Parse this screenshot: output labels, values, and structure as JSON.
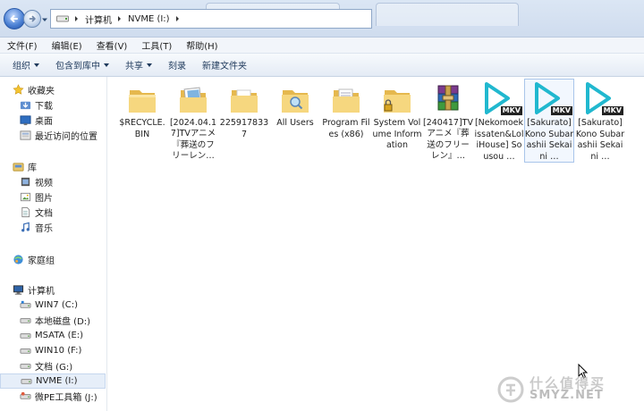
{
  "address": {
    "crumbs": [
      "计算机",
      "NVME (I:)"
    ]
  },
  "menu": [
    "文件(F)",
    "编辑(E)",
    "查看(V)",
    "工具(T)",
    "帮助(H)"
  ],
  "toolbar": {
    "organize": "组织",
    "include_in_library": "包含到库中",
    "share": "共享",
    "burn": "刻录",
    "new_folder": "新建文件夹"
  },
  "nav": {
    "favorites": "收藏夹",
    "downloads": "下载",
    "desktop": "桌面",
    "recent": "最近访问的位置",
    "libraries": "库",
    "videos": "视频",
    "pictures": "图片",
    "documents": "文档",
    "music": "音乐",
    "homegroup": "家庭组",
    "computer": "计算机",
    "drives": [
      {
        "label": "WIN7 (C:)"
      },
      {
        "label": "本地磁盘 (D:)"
      },
      {
        "label": "MSATA (E:)"
      },
      {
        "label": "WIN10 (F:)"
      },
      {
        "label": "文档 (G:)"
      },
      {
        "label": "NVME (I:)"
      },
      {
        "label": "微PE工具箱 (J:)"
      }
    ]
  },
  "files": [
    {
      "label": "$RECYCLE.BIN",
      "icon": "folder-icon"
    },
    {
      "label": "[2024.04.17]TVアニメ『葬送のフリーレン…",
      "icon": "folder-images-icon"
    },
    {
      "label": "2259178337",
      "icon": "folder-icon"
    },
    {
      "label": "All Users",
      "icon": "folder-search-icon"
    },
    {
      "label": "Program Files (x86)",
      "icon": "folder-docs-icon"
    },
    {
      "label": "System Volume Information",
      "icon": "locked-folder-icon"
    },
    {
      "label": "[240417]TVアニメ『葬送のフリーレン』…",
      "icon": "winrar-archive-icon"
    },
    {
      "label": "[Nekomoekissaten&LoliHouse] Sousou …",
      "icon": "mkv-file-icon"
    },
    {
      "label": "[Sakurato] Kono Subarashii Sekai ni …",
      "icon": "mkv-file-icon"
    },
    {
      "label": "[Sakurato] Kono Subarashii Sekai ni …",
      "icon": "mkv-file-icon"
    }
  ],
  "mkv_badge": "MKV",
  "watermark": {
    "cn": "什么值得买",
    "en": "SMYZ.NET"
  },
  "colors": {
    "folder": "#f2cd6b",
    "mkv": "#21b8cf",
    "accent": "#1e395b"
  }
}
